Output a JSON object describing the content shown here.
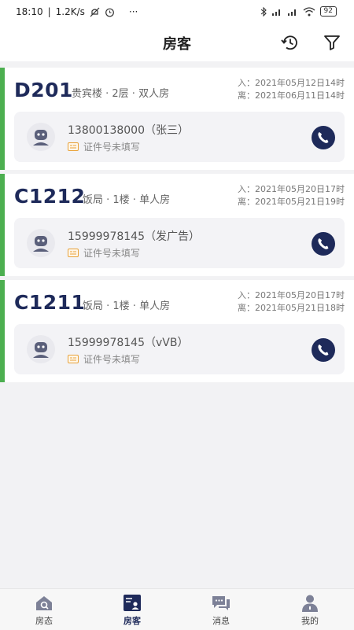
{
  "status_bar": {
    "time": "18:10",
    "speed": "1.2K/s",
    "dots": "···",
    "battery": "92"
  },
  "header": {
    "title": "房客"
  },
  "cards": [
    {
      "room": "D201",
      "info": "贵宾楼 · 2层 · 双人房",
      "checkin": "入：2021年05月12日14时",
      "checkout": "离：2021年06月11日14时",
      "guest": "13800138000（张三）",
      "id_text": "证件号未填写"
    },
    {
      "room": "C1212",
      "info": "饭局 · 1楼 · 单人房",
      "checkin": "入：2021年05月20日17时",
      "checkout": "离：2021年05月21日19时",
      "guest": "15999978145（发广告）",
      "id_text": "证件号未填写"
    },
    {
      "room": "C1211",
      "info": "饭局 · 1楼 · 单人房",
      "checkin": "入：2021年05月20日17时",
      "checkout": "离：2021年05月21日18时",
      "guest": "15999978145（vVB）",
      "id_text": "证件号未填写"
    }
  ],
  "tabs": [
    {
      "label": "房态",
      "icon": "house-icon"
    },
    {
      "label": "房客",
      "icon": "guest-card-icon"
    },
    {
      "label": "消息",
      "icon": "message-icon"
    },
    {
      "label": "我的",
      "icon": "person-icon"
    }
  ],
  "colors": {
    "accent": "#1e2a5a",
    "card_stripe": "#4caf50",
    "id_badge": "#e8a23a"
  }
}
